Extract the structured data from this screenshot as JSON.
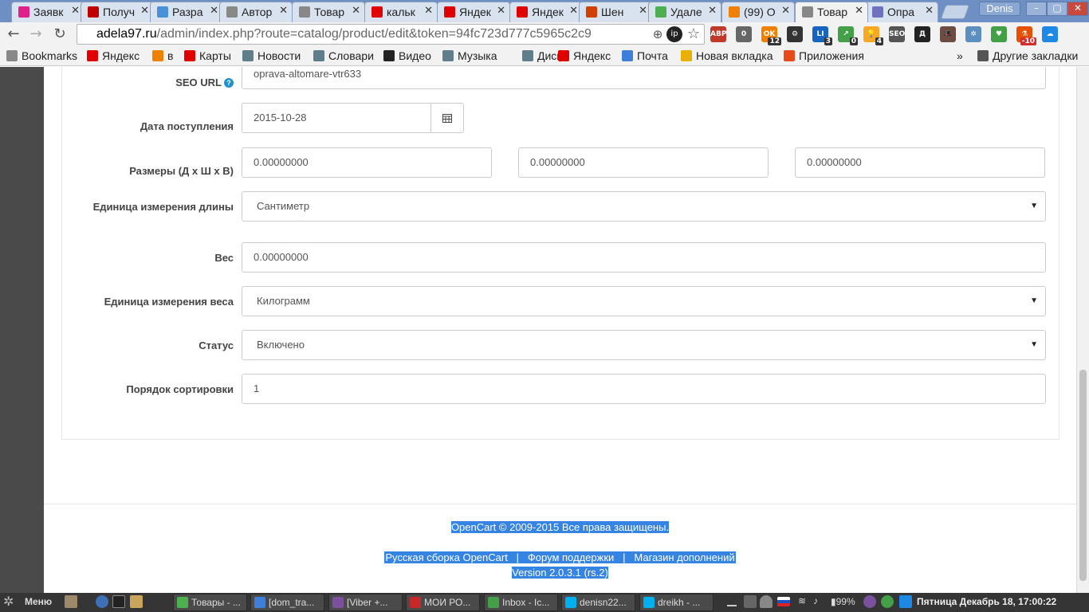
{
  "browser": {
    "tabs": [
      {
        "label": "Заявк",
        "icon_color": "#e0218a"
      },
      {
        "label": "Получ",
        "icon_color": "#c00000"
      },
      {
        "label": "Разра",
        "icon_color": "#4a90d9"
      },
      {
        "label": "Автор",
        "icon_color": "#888888"
      },
      {
        "label": "Товар",
        "icon_color": "#888888"
      },
      {
        "label": "кальк",
        "icon_color": "#e00000"
      },
      {
        "label": "Яндек",
        "icon_color": "#e00000"
      },
      {
        "label": "Яндек",
        "icon_color": "#e00000"
      },
      {
        "label": "Шен",
        "icon_color": "#d04000"
      },
      {
        "label": "Удале",
        "icon_color": "#4caf50"
      },
      {
        "label": "(99) О",
        "icon_color": "#f08000"
      },
      {
        "label": "Товар",
        "icon_color": "#888888",
        "active": true
      },
      {
        "label": "Опра",
        "icon_color": "#7070c0"
      }
    ],
    "user_badge": "Denis",
    "url_domain": "adela97.ru",
    "url_path": "/admin/index.php?route=catalog/product/edit&token=94fc723d777c5965c2c9",
    "extensions": [
      {
        "label": "ABP",
        "color": "#c0392b"
      },
      {
        "label": "0",
        "color": "#666666"
      },
      {
        "label": "OK",
        "color": "#f08000",
        "badge": "12"
      },
      {
        "label": "⚙",
        "color": "#333333"
      },
      {
        "label": "LI",
        "color": "#1565c0",
        "badge": "3"
      },
      {
        "label": "↗",
        "color": "#43a047",
        "badge": "0"
      },
      {
        "label": "💡",
        "color": "#f9a825",
        "badge": "4"
      },
      {
        "label": "SEO",
        "color": "#555555"
      },
      {
        "label": "Д",
        "color": "#222222"
      },
      {
        "label": "🎩",
        "color": "#6d4c41"
      },
      {
        "label": "✲",
        "color": "#5c8fbf"
      },
      {
        "label": "♥",
        "color": "#43a047"
      },
      {
        "label": "⚗",
        "color": "#e65100",
        "badge": "-10"
      },
      {
        "label": "☁",
        "color": "#1e88e5"
      }
    ],
    "bookmarks": [
      {
        "label": "Bookmarks",
        "icon_color": "#888888"
      },
      {
        "label": "Яндекс",
        "icon_color": "#e00000"
      },
      {
        "label": "в",
        "icon_color": "#f08000"
      },
      {
        "label": "Карты",
        "icon_color": "#e00000"
      },
      {
        "label": "Новости",
        "icon_color": "#607d8b"
      },
      {
        "label": "Словари",
        "icon_color": "#607d8b"
      },
      {
        "label": "Видео",
        "icon_color": "#222222"
      },
      {
        "label": "Музыка",
        "icon_color": "#607d8b"
      },
      {
        "label": "Диск",
        "icon_color": "#607d8b"
      },
      {
        "label": "Яндекс",
        "icon_color": "#e00000"
      },
      {
        "label": "Почта",
        "icon_color": "#3f7fd9"
      },
      {
        "label": "Новая вкладка",
        "icon_color": "#e8b000"
      },
      {
        "label": "Приложения",
        "icon_color": "#e64a19"
      }
    ],
    "bookmarks_more": "»",
    "other_bookmarks": "Другие закладки"
  },
  "form": {
    "seo_url": {
      "label": "SEO URL",
      "help": "?",
      "value": "oprava-altomare-vtr633"
    },
    "date_available": {
      "label": "Дата поступления",
      "value": "2015-10-28"
    },
    "dimensions": {
      "label": "Размеры (Д х Ш х В)",
      "length": "0.00000000",
      "width": "0.00000000",
      "height": "0.00000000"
    },
    "length_class": {
      "label": "Единица измерения длины",
      "value": "Сантиметр"
    },
    "weight": {
      "label": "Вес",
      "value": "0.00000000"
    },
    "weight_class": {
      "label": "Единица измерения веса",
      "value": "Килограмм"
    },
    "status": {
      "label": "Статус",
      "value": "Включено"
    },
    "sort_order": {
      "label": "Порядок сортировки",
      "value": "1"
    }
  },
  "footer": {
    "copyright": "OpenCart © 2009-2015 Все права защищены.",
    "link1": "Русская сборка OpenCart",
    "sep": "|",
    "link2": "Форум поддержки",
    "link3": "Магазин дополнений",
    "version": "Version 2.0.3.1 (rs.2)"
  },
  "taskbar": {
    "menu": "Меню",
    "windows": [
      {
        "label": "Товары - ...",
        "icon_color": "#4caf50"
      },
      {
        "label": "[dom_tra...",
        "icon_color": "#3f7fd9"
      },
      {
        "label": "[Viber +...",
        "icon_color": "#7b519d"
      },
      {
        "label": "МОИ РО...",
        "icon_color": "#c62828"
      },
      {
        "label": "Inbox - Ic...",
        "icon_color": "#43a047"
      },
      {
        "label": "denisn22...",
        "icon_color": "#00aff0"
      },
      {
        "label": "dreikh - ...",
        "icon_color": "#00aff0"
      }
    ],
    "battery": "99%",
    "clock": "Пятница Декабрь 18, 17:00:22"
  }
}
